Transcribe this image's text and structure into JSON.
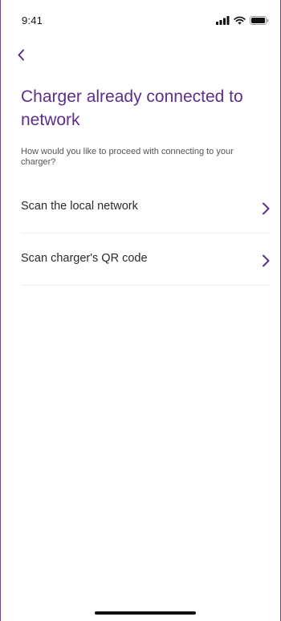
{
  "status_bar": {
    "time": "9:41",
    "icons": [
      "signal-icon",
      "wifi-icon",
      "battery-icon"
    ]
  },
  "navigation": {
    "back_icon": "chevron-left-icon"
  },
  "page": {
    "title": "Charger already connected to network",
    "prompt": "How would you like to proceed with connecting to your charger?"
  },
  "options": [
    {
      "label": "Scan the local network",
      "icon": "chevron-right-icon"
    },
    {
      "label": "Scan charger's QR code",
      "icon": "chevron-right-icon"
    }
  ],
  "colors": {
    "accent": "#5d2e8a",
    "text": "#2b2b2b",
    "secondary_text": "#555555",
    "divider": "#efedf2"
  }
}
